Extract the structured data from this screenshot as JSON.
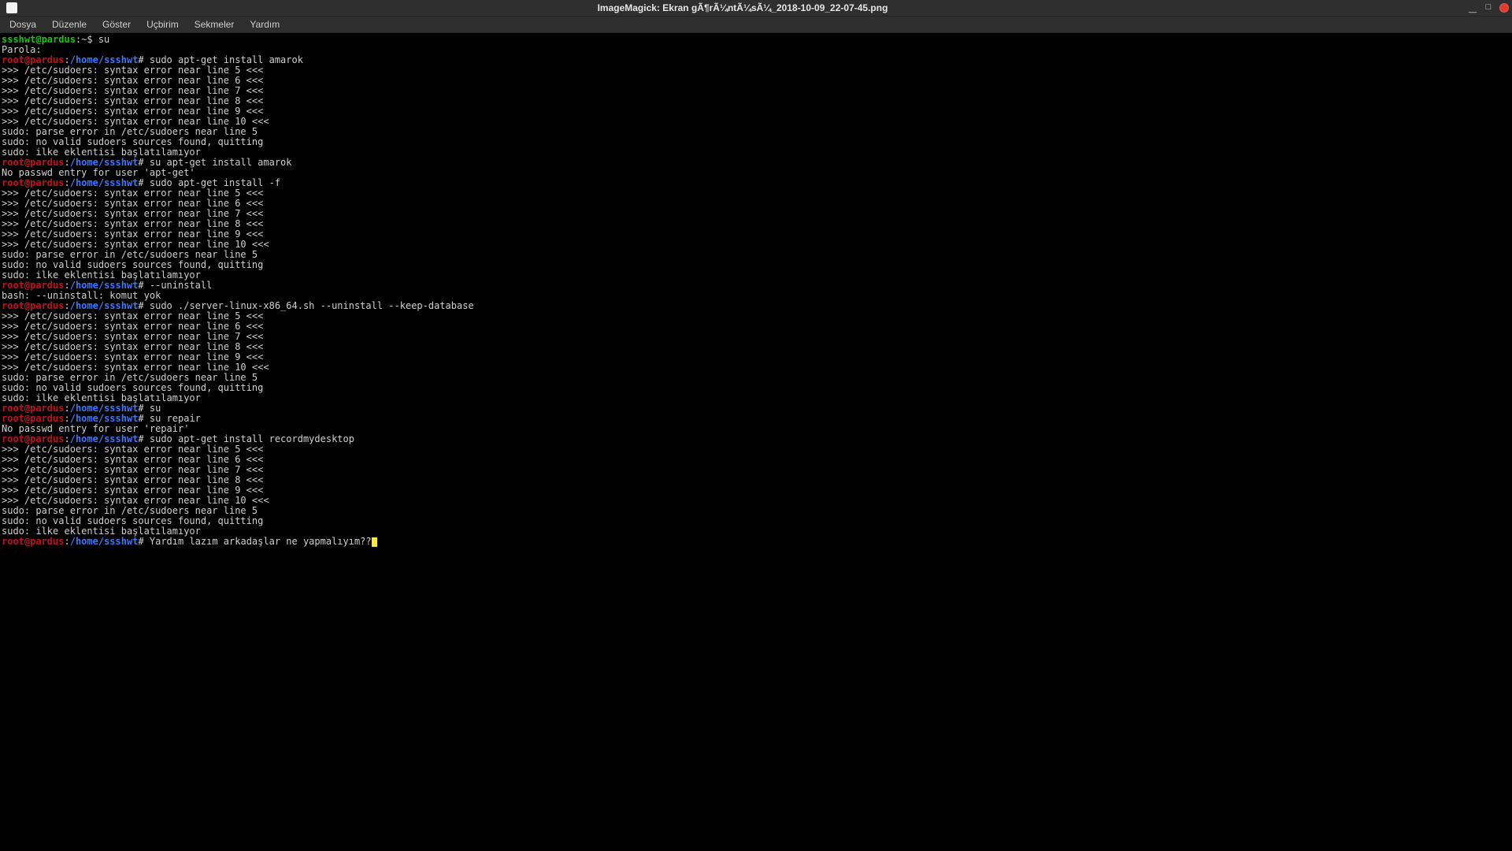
{
  "window": {
    "title": "ImageMagick: Ekran gÃ¶rÃ¼ntÃ¼sÃ¼_2018-10-09_22-07-45.png"
  },
  "menu": {
    "items": [
      "Dosya",
      "Düzenle",
      "Göster",
      "Uçbirim",
      "Sekmeler",
      "Yardım"
    ]
  },
  "prompt": {
    "user_host_normal": "ssshwt@pardus",
    "tilde": ":~$ ",
    "root_host": "root@pardus",
    "root_colon": ":",
    "root_path": "/home/ssshwt",
    "root_hash": "# "
  },
  "lines": [
    {
      "type": "user",
      "cmd": "su"
    },
    {
      "type": "out",
      "text": "Parola:"
    },
    {
      "type": "root",
      "cmd": "sudo apt-get install amarok"
    },
    {
      "type": "out",
      "text": ">>> /etc/sudoers: syntax error near line 5 <<<"
    },
    {
      "type": "out",
      "text": ">>> /etc/sudoers: syntax error near line 6 <<<"
    },
    {
      "type": "out",
      "text": ">>> /etc/sudoers: syntax error near line 7 <<<"
    },
    {
      "type": "out",
      "text": ">>> /etc/sudoers: syntax error near line 8 <<<"
    },
    {
      "type": "out",
      "text": ">>> /etc/sudoers: syntax error near line 9 <<<"
    },
    {
      "type": "out",
      "text": ">>> /etc/sudoers: syntax error near line 10 <<<"
    },
    {
      "type": "out",
      "text": "sudo: parse error in /etc/sudoers near line 5"
    },
    {
      "type": "out",
      "text": "sudo: no valid sudoers sources found, quitting"
    },
    {
      "type": "out",
      "text": "sudo: ilke eklentisi başlatılamıyor"
    },
    {
      "type": "root",
      "cmd": "su apt-get install amarok"
    },
    {
      "type": "out",
      "text": "No passwd entry for user 'apt-get'"
    },
    {
      "type": "root",
      "cmd": "sudo apt-get install -f"
    },
    {
      "type": "out",
      "text": ">>> /etc/sudoers: syntax error near line 5 <<<"
    },
    {
      "type": "out",
      "text": ">>> /etc/sudoers: syntax error near line 6 <<<"
    },
    {
      "type": "out",
      "text": ">>> /etc/sudoers: syntax error near line 7 <<<"
    },
    {
      "type": "out",
      "text": ">>> /etc/sudoers: syntax error near line 8 <<<"
    },
    {
      "type": "out",
      "text": ">>> /etc/sudoers: syntax error near line 9 <<<"
    },
    {
      "type": "out",
      "text": ">>> /etc/sudoers: syntax error near line 10 <<<"
    },
    {
      "type": "out",
      "text": "sudo: parse error in /etc/sudoers near line 5"
    },
    {
      "type": "out",
      "text": "sudo: no valid sudoers sources found, quitting"
    },
    {
      "type": "out",
      "text": "sudo: ilke eklentisi başlatılamıyor"
    },
    {
      "type": "root",
      "cmd": "--uninstall"
    },
    {
      "type": "out",
      "text": "bash: --uninstall: komut yok"
    },
    {
      "type": "root",
      "cmd": "sudo ./server-linux-x86_64.sh --uninstall --keep-database"
    },
    {
      "type": "out",
      "text": ">>> /etc/sudoers: syntax error near line 5 <<<"
    },
    {
      "type": "out",
      "text": ">>> /etc/sudoers: syntax error near line 6 <<<"
    },
    {
      "type": "out",
      "text": ">>> /etc/sudoers: syntax error near line 7 <<<"
    },
    {
      "type": "out",
      "text": ">>> /etc/sudoers: syntax error near line 8 <<<"
    },
    {
      "type": "out",
      "text": ">>> /etc/sudoers: syntax error near line 9 <<<"
    },
    {
      "type": "out",
      "text": ">>> /etc/sudoers: syntax error near line 10 <<<"
    },
    {
      "type": "out",
      "text": "sudo: parse error in /etc/sudoers near line 5"
    },
    {
      "type": "out",
      "text": "sudo: no valid sudoers sources found, quitting"
    },
    {
      "type": "out",
      "text": "sudo: ilke eklentisi başlatılamıyor"
    },
    {
      "type": "root",
      "cmd": "su"
    },
    {
      "type": "root",
      "cmd": "su repair"
    },
    {
      "type": "out",
      "text": "No passwd entry for user 'repair'"
    },
    {
      "type": "root",
      "cmd": "sudo apt-get install recordmydesktop"
    },
    {
      "type": "out",
      "text": ">>> /etc/sudoers: syntax error near line 5 <<<"
    },
    {
      "type": "out",
      "text": ">>> /etc/sudoers: syntax error near line 6 <<<"
    },
    {
      "type": "out",
      "text": ">>> /etc/sudoers: syntax error near line 7 <<<"
    },
    {
      "type": "out",
      "text": ">>> /etc/sudoers: syntax error near line 8 <<<"
    },
    {
      "type": "out",
      "text": ">>> /etc/sudoers: syntax error near line 9 <<<"
    },
    {
      "type": "out",
      "text": ">>> /etc/sudoers: syntax error near line 10 <<<"
    },
    {
      "type": "out",
      "text": "sudo: parse error in /etc/sudoers near line 5"
    },
    {
      "type": "out",
      "text": "sudo: no valid sudoers sources found, quitting"
    },
    {
      "type": "out",
      "text": "sudo: ilke eklentisi başlatılamıyor"
    },
    {
      "type": "root",
      "cmd": "Yardım lazım arkadaşlar ne yapmalıyım??",
      "cursor": true
    }
  ]
}
